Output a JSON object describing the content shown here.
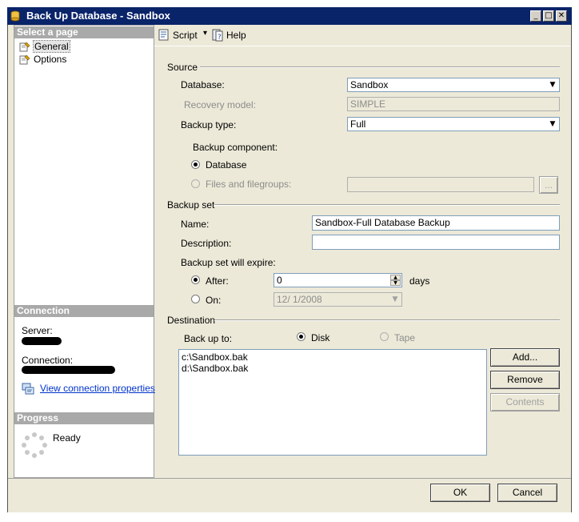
{
  "window": {
    "title": "Back Up Database - Sandbox",
    "controls": {
      "minimize": "_",
      "maximize": "□",
      "close": "✕"
    }
  },
  "left_panel": {
    "select_page_header": "Select a page",
    "pages": [
      {
        "label": "General",
        "selected": true
      },
      {
        "label": "Options",
        "selected": false
      }
    ],
    "connection_header": "Connection",
    "server_label": "Server:",
    "connection_label": "Connection:",
    "view_connection_link": "View connection properties",
    "progress_header": "Progress",
    "progress_status": "Ready"
  },
  "toolbar": {
    "script_label": "Script",
    "script_dropdown": "▾",
    "help_label": "Help"
  },
  "source": {
    "group_label": "Source",
    "database_label": "Database:",
    "database_value": "Sandbox",
    "recovery_model_label": "Recovery model:",
    "recovery_model_value": "SIMPLE",
    "backup_type_label": "Backup type:",
    "backup_type_value": "Full",
    "backup_component_label": "Backup component:",
    "component_database_label": "Database",
    "component_files_label": "Files and filegroups:",
    "browse_label": "..."
  },
  "backup_set": {
    "group_label": "Backup set",
    "name_label": "Name:",
    "name_value": "Sandbox-Full Database Backup",
    "description_label": "Description:",
    "description_value": "",
    "expire_label": "Backup set will expire:",
    "after_label": "After:",
    "after_value": "0",
    "days_label": "days",
    "on_label": "On:",
    "on_value": "12/  1/2008"
  },
  "destination": {
    "group_label": "Destination",
    "backup_to_label": "Back up to:",
    "disk_label": "Disk",
    "tape_label": "Tape",
    "files": [
      "c:\\Sandbox.bak",
      "d:\\Sandbox.bak"
    ],
    "add_label": "Add...",
    "remove_label": "Remove",
    "contents_label": "Contents"
  },
  "footer": {
    "ok_label": "OK",
    "cancel_label": "Cancel"
  },
  "colors": {
    "title_bar": "#0a246a",
    "dialog_bg": "#ece9d8",
    "section_header": "#a9a9a9",
    "link": "#0033cc"
  }
}
